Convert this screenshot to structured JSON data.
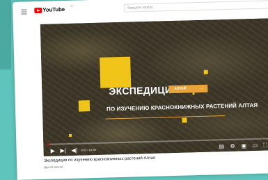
{
  "app": {
    "logo_text": "YouTube",
    "region": "RU"
  },
  "search": {
    "placeholder": "Введите запрос"
  },
  "video": {
    "title_line1": "ЭКСПЕДИЦИЯ",
    "tag": "АЛТАЙ",
    "tag_arrow": "→",
    "title_line2": "ПО ИЗУЧЕНИЮ КРАСНОКНИЖНЫХ РАСТЕНИЙ АЛТАЯ",
    "time": "0:02 / 10:56",
    "progress_fraction": 0.003,
    "accent_color": "#f0c419",
    "tag_color": "#e8a33a"
  },
  "caption": "Экспедиция по изучению краснокнижных растений Алтая",
  "channel": "Другой канала"
}
